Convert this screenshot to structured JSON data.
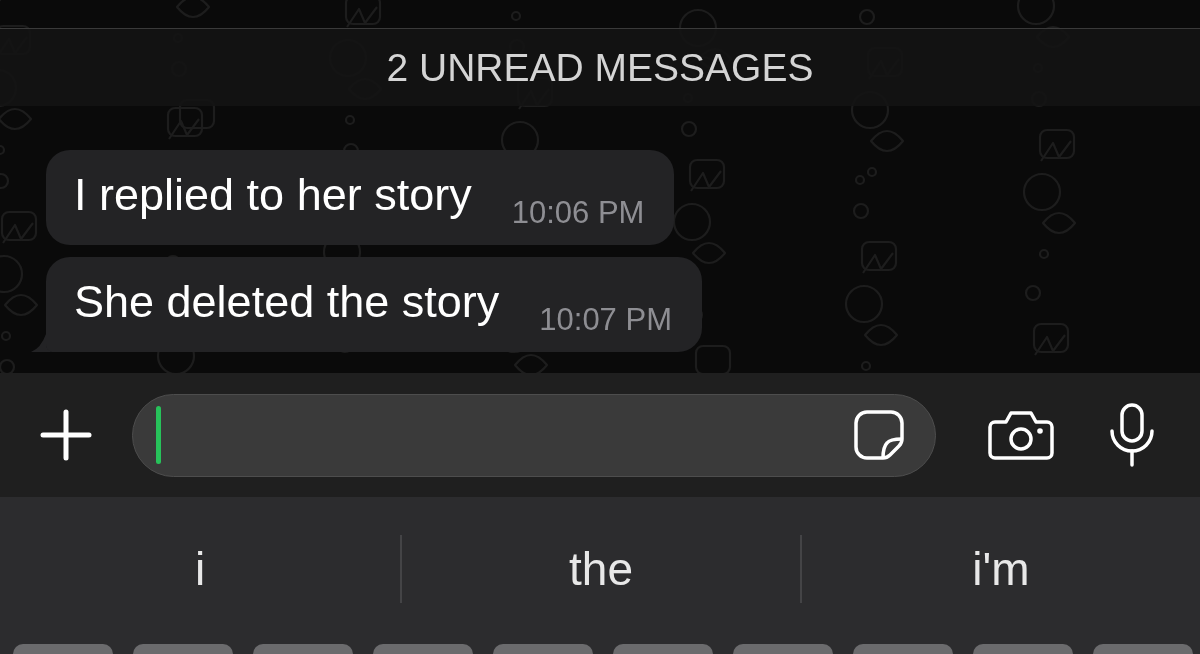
{
  "chat": {
    "unread_banner": "2 UNREAD MESSAGES",
    "messages": [
      {
        "text": "I replied to her story",
        "time": "10:06 PM",
        "tail": false
      },
      {
        "text": "She deleted the story",
        "time": "10:07 PM",
        "tail": true
      }
    ]
  },
  "composer": {
    "input": {
      "focused": true
    }
  },
  "keyboard": {
    "suggestions": [
      "i",
      "the",
      "i'm"
    ]
  }
}
